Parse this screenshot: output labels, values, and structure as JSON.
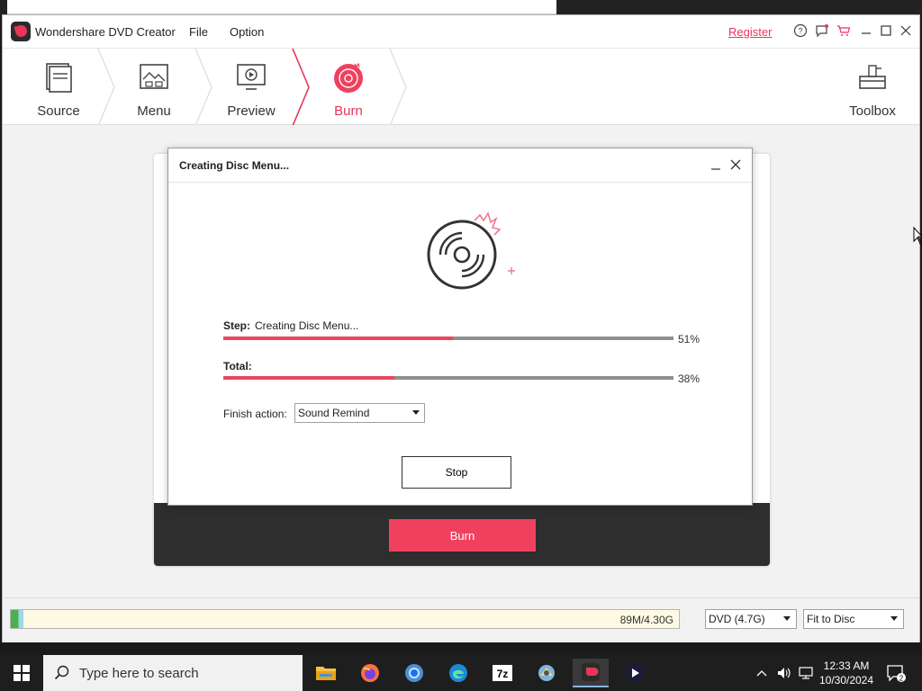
{
  "app": {
    "title": "Wondershare DVD Creator",
    "menu": [
      "File",
      "Option"
    ],
    "register": "Register"
  },
  "steps": [
    {
      "label": "Source",
      "icon": "source-icon"
    },
    {
      "label": "Menu",
      "icon": "menu-icon"
    },
    {
      "label": "Preview",
      "icon": "preview-icon"
    },
    {
      "label": "Burn",
      "icon": "burn-icon",
      "active": true
    }
  ],
  "toolbox": {
    "label": "Toolbox"
  },
  "burn_button": "Burn",
  "dialog": {
    "title": "Creating Disc Menu...",
    "step_label": "Step:",
    "step_value": "Creating Disc Menu...",
    "step_percent_text": "51%",
    "step_progress": 0.51,
    "total_label": "Total:",
    "total_percent_text": "38%",
    "total_progress": 0.38,
    "finish_label": "Finish action:",
    "finish_value": "Sound Remind",
    "stop_button": "Stop"
  },
  "status": {
    "capacity_text": "89M/4.30G",
    "disc_type": "DVD (4.7G)",
    "fit_mode": "Fit to Disc"
  },
  "taskbar": {
    "search_placeholder": "Type here to search",
    "time": "12:33 AM",
    "date": "10/30/2024",
    "notification_count": "2"
  },
  "colors": {
    "accent": "#e8355a",
    "progress": "#e8475f",
    "dark_panel": "#2e2e2e"
  }
}
